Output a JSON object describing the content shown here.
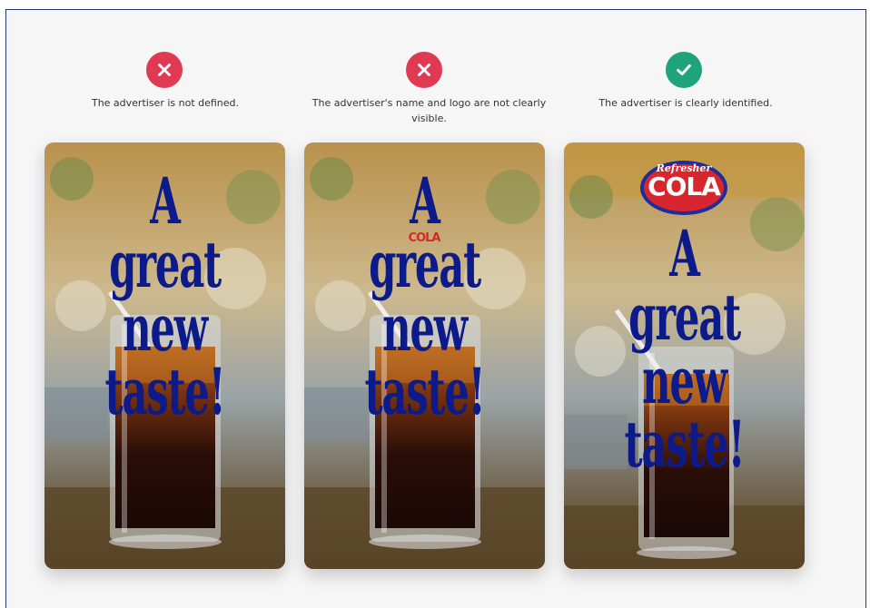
{
  "panels": [
    {
      "status": "bad",
      "status_icon": "x-icon",
      "caption": "The advertiser is not defined.",
      "headline_line1": "A great",
      "headline_line2": "new taste!"
    },
    {
      "status": "bad",
      "status_icon": "x-icon",
      "caption": "The advertiser's name and logo are not clearly visible.",
      "headline_line1": "A great",
      "headline_line2": "new taste!",
      "logo_top": "",
      "logo_main": "COLA"
    },
    {
      "status": "good",
      "status_icon": "check-icon",
      "caption": "The advertiser is clearly identified.",
      "headline_line1": "A great",
      "headline_line2": "new taste!",
      "logo_top": "Refresher",
      "logo_main": "COLA"
    }
  ],
  "colors": {
    "bad": "#e03a52",
    "good": "#1fa37a",
    "headline": "#0d1b8a",
    "logo_red": "#d8262f",
    "logo_blue": "#1a2e9c"
  }
}
